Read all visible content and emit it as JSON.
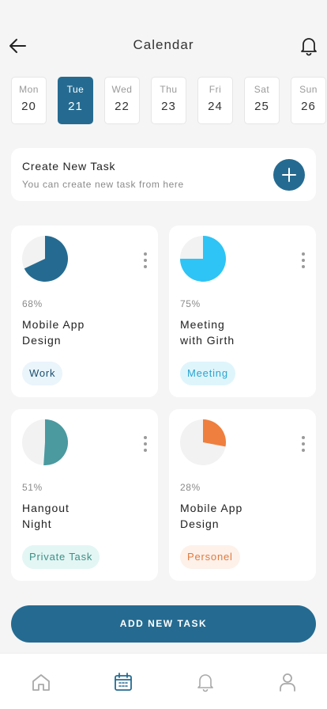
{
  "header": {
    "title": "Calendar",
    "back_icon": "arrow-left-icon",
    "bell_icon": "bell-icon"
  },
  "days": [
    {
      "name": "Mon",
      "date": "20",
      "active": false
    },
    {
      "name": "Tue",
      "date": "21",
      "active": true
    },
    {
      "name": "Wed",
      "date": "22",
      "active": false
    },
    {
      "name": "Thu",
      "date": "23",
      "active": false
    },
    {
      "name": "Fri",
      "date": "24",
      "active": false
    },
    {
      "name": "Sat",
      "date": "25",
      "active": false
    },
    {
      "name": "Sun",
      "date": "26",
      "active": false
    }
  ],
  "create_task": {
    "title": "Create New Task",
    "subtitle": "You can create new task from here",
    "icon": "plus-icon"
  },
  "tasks": [
    {
      "percent_label": "68%",
      "progress": 0.68,
      "name_line1": "Mobile App",
      "name_line2": "Design",
      "tag": "Work",
      "color": "#256b91",
      "tag_bg": "#eaf4fb",
      "tag_color": "#1c4f6e"
    },
    {
      "percent_label": "75%",
      "progress": 0.75,
      "name_line1": "Meeting",
      "name_line2": "with Girth",
      "tag": "Meeting",
      "color": "#2ec4f5",
      "tag_bg": "#dff5fc",
      "tag_color": "#2aa4cf"
    },
    {
      "percent_label": "51%",
      "progress": 0.51,
      "name_line1": "Hangout",
      "name_line2": "Night",
      "tag": "Private Task",
      "color": "#4a9aa0",
      "tag_bg": "#e3f6f4",
      "tag_color": "#3d8f86"
    },
    {
      "percent_label": "28%",
      "progress": 0.28,
      "name_line1": "Mobile App",
      "name_line2": "Design",
      "tag": "Personel",
      "color": "#ef7f3e",
      "tag_bg": "#fdf1ea",
      "tag_color": "#e07a3d"
    }
  ],
  "add_button_label": "ADD NEW TASK",
  "bottom_nav": [
    {
      "icon": "home-icon",
      "active": false
    },
    {
      "icon": "calendar-icon",
      "active": true
    },
    {
      "icon": "bell-icon",
      "active": false
    },
    {
      "icon": "user-icon",
      "active": false
    }
  ],
  "colors": {
    "accent": "#256b91",
    "inactive_icon": "#a9a9a9"
  }
}
